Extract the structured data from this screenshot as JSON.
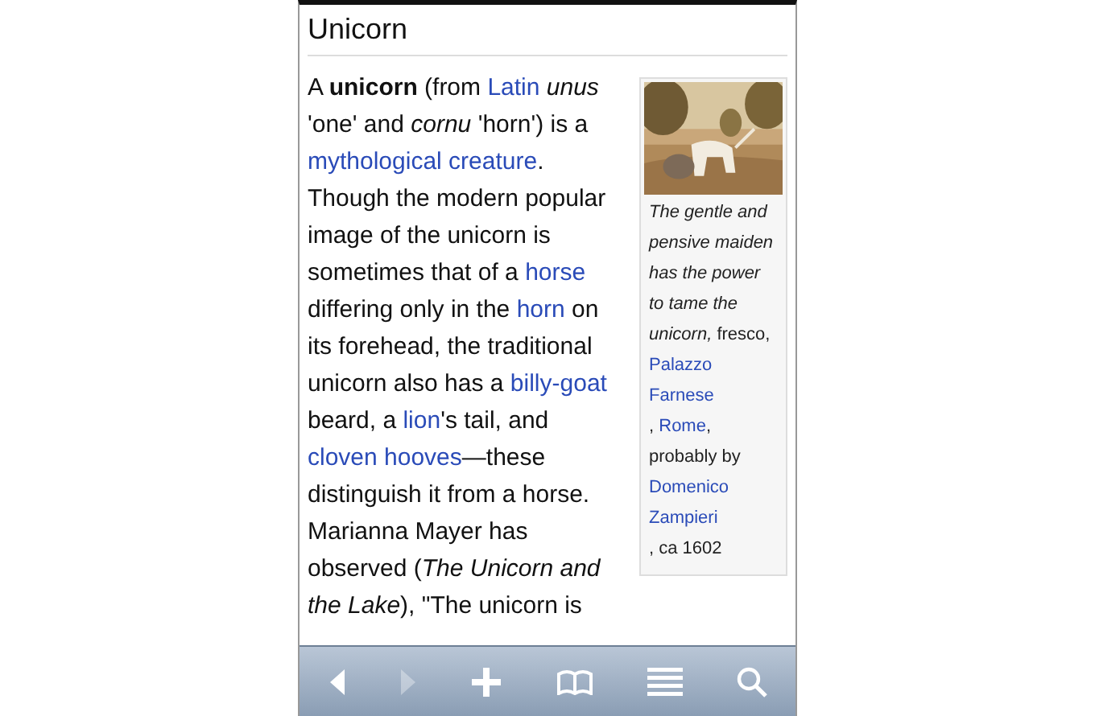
{
  "title": "Unicorn",
  "paragraph": [
    {
      "kind": "text",
      "text": "A **unicorn** (from "
    },
    {
      "kind": "link",
      "text": "Latin"
    },
    {
      "kind": "text",
      "text": " *unus* 'one' and *cornu* 'horn') is a "
    },
    {
      "kind": "link",
      "text": "mythological creature"
    },
    {
      "kind": "text",
      "text": ". Though the modern popular image of the unicorn is sometimes that of a "
    },
    {
      "kind": "link",
      "text": "horse"
    },
    {
      "kind": "text",
      "text": " differing only in the "
    },
    {
      "kind": "link",
      "text": "horn"
    },
    {
      "kind": "text",
      "text": " on its forehead, the traditional unicorn also has a "
    },
    {
      "kind": "link",
      "text": "billy-goat"
    },
    {
      "kind": "text",
      "text": " beard, a "
    },
    {
      "kind": "link",
      "text": "lion"
    },
    {
      "kind": "text",
      "text": "'s tail, and "
    },
    {
      "kind": "link",
      "text": "cloven hooves"
    },
    {
      "kind": "text",
      "text": "—these distinguish it from a horse. Marianna Mayer has observed (*The Unicorn and the Lake*), \"The unicorn is"
    }
  ],
  "infobox": {
    "caption": [
      {
        "kind": "text",
        "text": "*The gentle and pensive maiden has the power to tame the unicorn,* fresco, "
      },
      {
        "kind": "link",
        "text": "Palazzo Farnese"
      },
      {
        "kind": "text",
        "text": ", "
      },
      {
        "kind": "link",
        "text": "Rome"
      },
      {
        "kind": "text",
        "text": ", probably by "
      },
      {
        "kind": "link",
        "text": "Domenico Zampieri"
      },
      {
        "kind": "text",
        "text": ", ca 1602"
      }
    ]
  },
  "toolbar": [
    {
      "kind": "back",
      "disabled": false
    },
    {
      "kind": "forward",
      "disabled": true
    },
    {
      "kind": "add",
      "disabled": false
    },
    {
      "kind": "bookmarks",
      "disabled": false
    },
    {
      "kind": "list",
      "disabled": false
    },
    {
      "kind": "search",
      "disabled": false
    }
  ]
}
